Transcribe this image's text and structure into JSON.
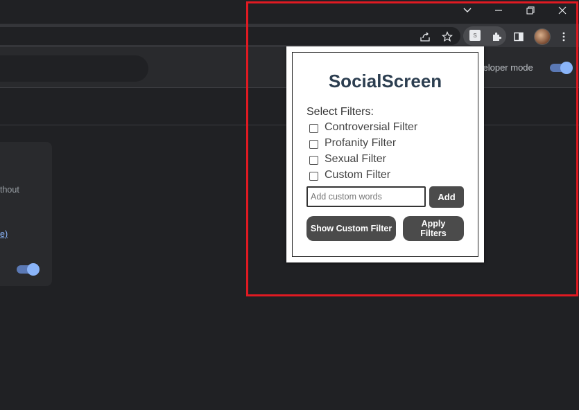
{
  "page": {
    "developer_mode_label": "veloper mode",
    "card_text": "thout",
    "card_link": "e)"
  },
  "popup": {
    "title": "SocialScreen",
    "select_label": "Select Filters:",
    "filters": [
      {
        "label": "Controversial Filter",
        "checked": false
      },
      {
        "label": "Profanity Filter",
        "checked": false
      },
      {
        "label": "Sexual Filter",
        "checked": false
      },
      {
        "label": "Custom Filter",
        "checked": false
      }
    ],
    "custom_input": {
      "value": "",
      "placeholder": "Add custom words"
    },
    "add_label": "Add",
    "show_custom_label": "Show Custom Filter",
    "apply_label": "Apply Filters"
  },
  "colors": {
    "highlight": "#e01a22",
    "button": "#4b4b4b",
    "title": "#2c3e50",
    "toggle_on": "#8ab4f8"
  },
  "icons": [
    "chevron-down-icon",
    "minimize-icon",
    "restore-icon",
    "close-icon",
    "share-icon",
    "star-icon",
    "socialscreen-extension-icon",
    "puzzle-icon",
    "side-panel-icon",
    "avatar",
    "more-vert-icon"
  ]
}
